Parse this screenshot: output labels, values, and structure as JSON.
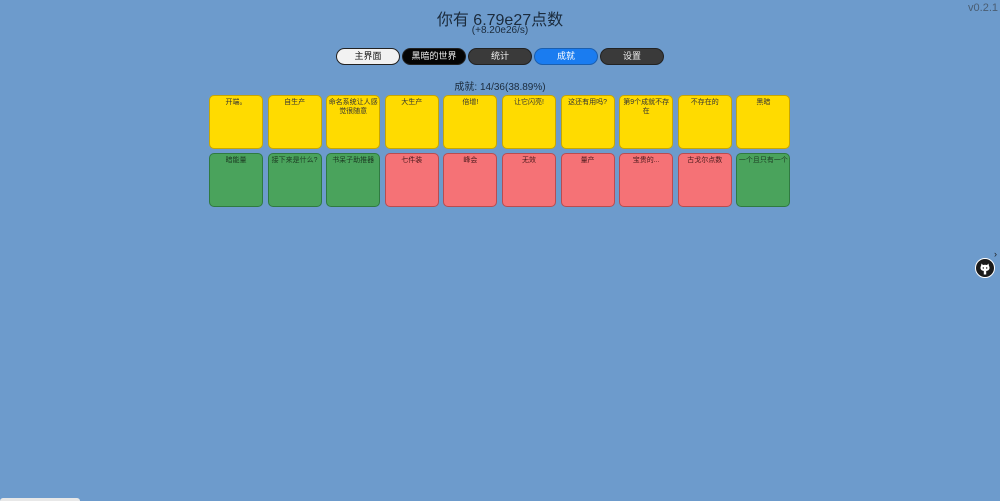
{
  "version": "v0.2.1",
  "header": {
    "points": "你有 6.79e27点数",
    "rate": "(+8.20e26/s)"
  },
  "tabs": [
    {
      "label": "主界面",
      "style": "light"
    },
    {
      "label": "黑暗的世界",
      "style": "black"
    },
    {
      "label": "统计",
      "style": "gray"
    },
    {
      "label": "成就",
      "style": "blue",
      "active": true
    },
    {
      "label": "设置",
      "style": "gray"
    }
  ],
  "achievements_summary": "成就: 14/36(38.89%)",
  "achievements": [
    {
      "label": "开端。",
      "color": "yellow"
    },
    {
      "label": "自生产",
      "color": "yellow"
    },
    {
      "label": "命名系统让人感觉很随意",
      "color": "yellow"
    },
    {
      "label": "大生产",
      "color": "yellow"
    },
    {
      "label": "倍增!",
      "color": "yellow"
    },
    {
      "label": "让它闪亮!",
      "color": "yellow"
    },
    {
      "label": "这还有用吗?",
      "color": "yellow"
    },
    {
      "label": "第9个成就不存在",
      "color": "yellow"
    },
    {
      "label": "不存在的",
      "color": "yellow"
    },
    {
      "label": "黑暗",
      "color": "yellow"
    },
    {
      "label": "暗能量",
      "color": "green"
    },
    {
      "label": "接下来是什么?",
      "color": "green"
    },
    {
      "label": "书呆子助推器",
      "color": "green"
    },
    {
      "label": "七件装",
      "color": "red"
    },
    {
      "label": "峰会",
      "color": "red"
    },
    {
      "label": "无效",
      "color": "red"
    },
    {
      "label": "量产",
      "color": "red"
    },
    {
      "label": "宝贵的...",
      "color": "red"
    },
    {
      "label": "古戈尔点数",
      "color": "red"
    },
    {
      "label": "一个且只有一个",
      "color": "green"
    }
  ],
  "side": {
    "icon": "github-icon",
    "chevron": "›"
  }
}
